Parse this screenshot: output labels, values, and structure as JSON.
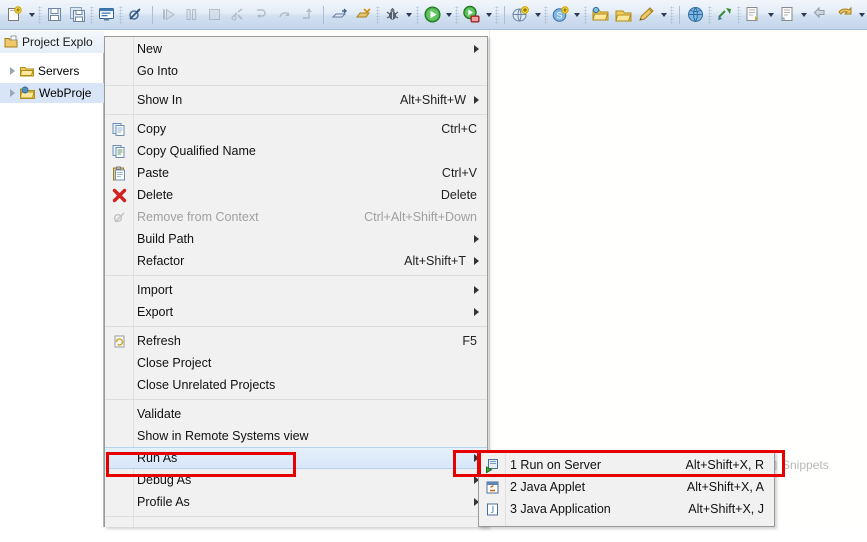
{
  "window": {
    "title": "Eclipse IDE"
  },
  "toolbar": {
    "groups": [
      {
        "buttons": [
          {
            "name": "new-wizard",
            "icon": "new-file-icon",
            "has_arrow": true
          },
          {
            "name": "save",
            "icon": "save-icon",
            "has_arrow": false
          },
          {
            "name": "save-all",
            "icon": "save-all-icon",
            "has_arrow": false
          },
          {
            "name": "console",
            "icon": "console-icon",
            "has_arrow": false
          },
          {
            "name": "skip-breakpoints",
            "icon": "skip-breakpoints-icon",
            "has_arrow": false
          }
        ]
      },
      {
        "buttons": [
          {
            "name": "resume",
            "icon": "resume-icon",
            "has_arrow": false
          },
          {
            "name": "suspend",
            "icon": "suspend-icon",
            "has_arrow": false
          },
          {
            "name": "terminate",
            "icon": "terminate-icon",
            "has_arrow": false
          },
          {
            "name": "disconnect",
            "icon": "disconnect-icon",
            "has_arrow": false
          },
          {
            "name": "step-into",
            "icon": "step-into-icon",
            "has_arrow": false
          },
          {
            "name": "step-over",
            "icon": "step-over-icon",
            "has_arrow": false
          },
          {
            "name": "step-return",
            "icon": "step-return-icon",
            "has_arrow": false
          }
        ]
      },
      {
        "buttons": [
          {
            "name": "open-type",
            "icon": "open-type-icon",
            "has_arrow": false
          },
          {
            "name": "open-task",
            "icon": "open-task-icon",
            "has_arrow": false
          },
          {
            "name": "debug",
            "icon": "debug-bug-icon",
            "has_arrow": true
          },
          {
            "name": "run",
            "icon": "run-play-icon",
            "has_arrow": true
          },
          {
            "name": "run-on-server",
            "icon": "run-server-icon",
            "has_arrow": true
          }
        ]
      },
      {
        "buttons": [
          {
            "name": "new-server",
            "icon": "new-server-icon",
            "has_arrow": true
          },
          {
            "name": "new-sql",
            "icon": "sql-icon",
            "has_arrow": true
          },
          {
            "name": "open-folder",
            "icon": "open-folder-icon",
            "has_arrow": false
          },
          {
            "name": "import-project",
            "icon": "import-icon",
            "has_arrow": false
          },
          {
            "name": "search",
            "icon": "search-pencil-icon",
            "has_arrow": true
          }
        ]
      },
      {
        "buttons": [
          {
            "name": "open-browser",
            "icon": "globe-icon",
            "has_arrow": false
          },
          {
            "name": "link-editor",
            "icon": "link-icon",
            "has_arrow": false
          },
          {
            "name": "next-annotation",
            "icon": "next-annotation-icon",
            "has_arrow": true
          },
          {
            "name": "previous-annotation",
            "icon": "previous-annotation-icon",
            "has_arrow": true
          },
          {
            "name": "back",
            "icon": "back-arrow-icon",
            "has_arrow": false
          },
          {
            "name": "forward",
            "icon": "forward-arrow-icon",
            "has_arrow": true
          }
        ]
      }
    ]
  },
  "left_panel": {
    "tab_label": "Project Explo",
    "tab_icon": "project-explorer-icon",
    "tree": [
      {
        "label": "Servers",
        "icon": "folder-icon",
        "selected": false,
        "expandable": true
      },
      {
        "label": "WebProje",
        "icon": "web-project-icon",
        "selected": true,
        "expandable": true
      }
    ]
  },
  "background": {
    "snippets_label": "Snippets",
    "snippets_icon": "snippets-icon"
  },
  "context_menu": {
    "items": [
      {
        "type": "item",
        "label": "New",
        "accel": "",
        "icon": "",
        "submenu": true,
        "disabled": false
      },
      {
        "type": "item",
        "label": "Go Into",
        "accel": "",
        "icon": "",
        "submenu": false,
        "disabled": false
      },
      {
        "type": "separator"
      },
      {
        "type": "item",
        "label": "Show In",
        "accel": "Alt+Shift+W",
        "icon": "",
        "submenu": true,
        "disabled": false
      },
      {
        "type": "separator"
      },
      {
        "type": "item",
        "label": "Copy",
        "accel": "Ctrl+C",
        "icon": "copy-icon",
        "submenu": false,
        "disabled": false
      },
      {
        "type": "item",
        "label": "Copy Qualified Name",
        "accel": "",
        "icon": "copy-qualified-icon",
        "submenu": false,
        "disabled": false
      },
      {
        "type": "item",
        "label": "Paste",
        "accel": "Ctrl+V",
        "icon": "paste-icon",
        "submenu": false,
        "disabled": false
      },
      {
        "type": "item",
        "label": "Delete",
        "accel": "Delete",
        "icon": "delete-x-icon",
        "submenu": false,
        "disabled": false
      },
      {
        "type": "item",
        "label": "Remove from Context",
        "accel": "Ctrl+Alt+Shift+Down",
        "icon": "remove-context-icon",
        "submenu": false,
        "disabled": true
      },
      {
        "type": "item",
        "label": "Build Path",
        "accel": "",
        "icon": "",
        "submenu": true,
        "disabled": false
      },
      {
        "type": "item",
        "label": "Refactor",
        "accel": "Alt+Shift+T",
        "icon": "",
        "submenu": true,
        "disabled": false
      },
      {
        "type": "separator"
      },
      {
        "type": "item",
        "label": "Import",
        "accel": "",
        "icon": "",
        "submenu": true,
        "disabled": false
      },
      {
        "type": "item",
        "label": "Export",
        "accel": "",
        "icon": "",
        "submenu": true,
        "disabled": false
      },
      {
        "type": "separator"
      },
      {
        "type": "item",
        "label": "Refresh",
        "accel": "F5",
        "icon": "refresh-icon",
        "submenu": false,
        "disabled": false
      },
      {
        "type": "item",
        "label": "Close Project",
        "accel": "",
        "icon": "",
        "submenu": false,
        "disabled": false
      },
      {
        "type": "item",
        "label": "Close Unrelated Projects",
        "accel": "",
        "icon": "",
        "submenu": false,
        "disabled": false
      },
      {
        "type": "separator"
      },
      {
        "type": "item",
        "label": "Validate",
        "accel": "",
        "icon": "",
        "submenu": false,
        "disabled": false
      },
      {
        "type": "item",
        "label": "Show in Remote Systems view",
        "accel": "",
        "icon": "",
        "submenu": false,
        "disabled": false
      },
      {
        "type": "item",
        "label": "Run As",
        "accel": "",
        "icon": "",
        "submenu": true,
        "disabled": false,
        "highlighted": true
      },
      {
        "type": "item",
        "label": "Debug As",
        "accel": "",
        "icon": "",
        "submenu": true,
        "disabled": false
      },
      {
        "type": "item",
        "label": "Profile As",
        "accel": "",
        "icon": "",
        "submenu": true,
        "disabled": false
      },
      {
        "type": "separator"
      },
      {
        "type": "item",
        "label": "",
        "accel": "",
        "icon": "",
        "submenu": false,
        "disabled": false
      }
    ]
  },
  "submenu": {
    "parent": "Run As",
    "items": [
      {
        "label": "1 Run on Server",
        "accel": "Alt+Shift+X, R",
        "icon": "run-on-server-icon"
      },
      {
        "label": "2 Java Applet",
        "accel": "Alt+Shift+X, A",
        "icon": "java-applet-icon"
      },
      {
        "label": "3 Java Application",
        "accel": "Alt+Shift+X, J",
        "icon": "java-application-icon"
      }
    ]
  },
  "annotations": {
    "color": "#e60000",
    "boxes": [
      {
        "name": "run-as-highlight",
        "target": "Run As"
      },
      {
        "name": "run-as-arrow-highlight",
        "target": "Run As submenu arrow"
      },
      {
        "name": "run-on-server-highlight",
        "target": "1 Run on Server"
      }
    ]
  }
}
